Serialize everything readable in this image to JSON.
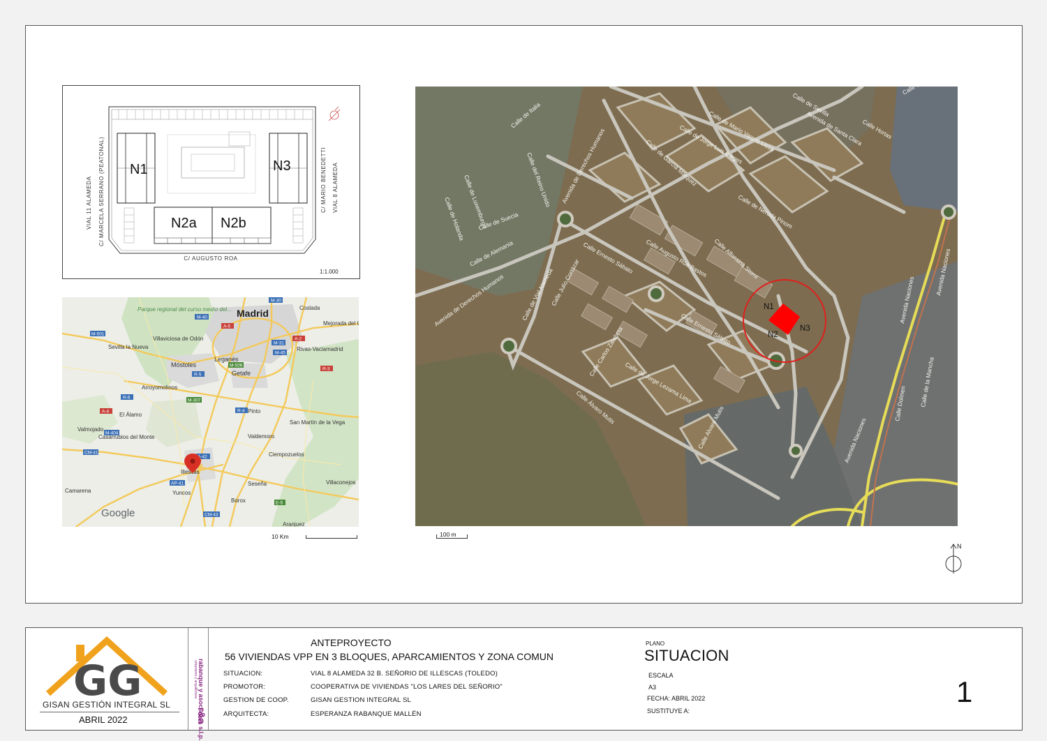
{
  "site_plan": {
    "blocks": {
      "n1": "N1",
      "n2a": "N2a",
      "n2b": "N2b",
      "n3": "N3"
    },
    "streets": {
      "left_outer": "VIAL 11 ALAMEDA",
      "left_inner": "C/ MARCELA SERRANO   (PEATONAL)",
      "right_inner": "C/ MARIO BENEDETTI",
      "right_outer": "VIAL 8 ALAMEDA",
      "bottom": "C/ AUGUSTO ROA"
    },
    "scale": "1:1.000"
  },
  "region_map": {
    "places": {
      "madrid": "Madrid",
      "coslada": "Coslada",
      "mejorada": "Mejorada del Campo",
      "parque": "Parque regional del curso medio del...",
      "villaviciosa": "Villaviciosa de Odón",
      "sevilla": "Sevilla la Nueva",
      "mostoles": "Móstoles",
      "leganes": "Leganés",
      "rivas": "Rivas-Vaciamadrid",
      "getafe": "Getafe",
      "arroyomolinos": "Arroyomolinos",
      "pinto": "Pinto",
      "elalamo": "El Álamo",
      "valmojado": "Valmojado",
      "casarrubios": "Casarrubios del Monte",
      "sanmartin": "San Martín de la Vega",
      "valdemoro": "Valdemoro",
      "ciempozuelos": "Ciempozuelos",
      "illescas": "Illescas",
      "camarena": "Camarena",
      "sesena": "Seseña",
      "yuncos": "Yuncos",
      "borox": "Borox",
      "villaconejos": "Villaconejos",
      "aranjuez": "Aranjuez"
    },
    "roads": {
      "m30": "M-30",
      "m40": "M-40",
      "a5": "A-5",
      "m501": "M-501",
      "m31": "M-31",
      "m45": "M-45",
      "a2": "A-2",
      "m506": "M-506",
      "r5": "R-5",
      "r4": "R-4",
      "r3": "R-3",
      "r6": "R-6",
      "m307": "M-307",
      "a4": "A-4",
      "m404": "M-404",
      "a42": "A-42",
      "cm41": "CM-41",
      "ap41": "AP-41",
      "e5": "E-5",
      "cm43": "CM-43"
    },
    "google": "Google",
    "scale_label": "10 Km"
  },
  "satellite": {
    "streets": [
      "Calle de Italia",
      "Calle de Luxemburgo",
      "Calle del Reino Unido",
      "Calle de Holanda",
      "Calle de Suecia",
      "Calle de Alemania",
      "Avenida de Derechos Humanos",
      "Avenida de Derechos Humanos",
      "Calle de Vial Alameda",
      "Calle Julio Cortázar",
      "Calle Ernesto Sábato",
      "Calle Ernesto Sábato",
      "Calle Carlos Zalabeta",
      "Calle de Jorge Lezama Lima",
      "Calle Álvaro Mutis",
      "Calle Alvaro Mutis",
      "Calle Augusto Roa Bastos",
      "Calle Alfonsina Storni",
      "Calle de García Márquez",
      "Calle de Jorge Luis Borges",
      "Calle de Mario Vargas Llosa",
      "Calle de Neruda Pinom",
      "Avenida de Santa Clara",
      "Calle de Sevilla",
      "Calle Hortas",
      "Calle de Creta",
      "Avenida Naciones",
      "Avenida Naciones",
      "Calle Dolmen",
      "Calle de la Mancha",
      "Avenida Naciones"
    ],
    "markers": {
      "n1": "N1",
      "n2": "N2",
      "n3": "N3"
    },
    "scale_label": "100 m",
    "highlight_color": "#ff0000"
  },
  "north_label": "N",
  "title_block": {
    "company": "GISAN GESTIÓN INTEGRAL SL",
    "date": "ABRIL 2022",
    "partner": "rabanque y asociados s.l.p.",
    "partner_sub": "urbanismo y arquitectura",
    "partner_mark": "r&a",
    "project_type": "ANTEPROYECTO",
    "project_title": "56 VIVIENDAS VPP EN 3 BLOQUES, APARCAMIENTOS Y ZONA COMUN",
    "rows": [
      {
        "label": "SITUACION:",
        "value": "VIAL 8 ALAMEDA 32 B. SEÑORIO DE ILLESCAS (TOLEDO)"
      },
      {
        "label": "PROMOTOR:",
        "value": "COOPERATIVA DE VIVIENDAS \"LOS LARES DEL SEÑORIO\""
      },
      {
        "label": "GESTION DE COOP.",
        "value": "GISAN GESTION INTEGRAL SL"
      },
      {
        "label": "ARQUITECTA:",
        "value": "ESPERANZA RABANQUE MALLÉN"
      }
    ],
    "plano_label": "PLANO",
    "plano_name": "SITUACION",
    "escala_label": "ESCALA",
    "format": "A3",
    "fecha": "FECHA:  ABRIL 2022",
    "sustituye": "SUSTITUYE A:",
    "sheet_number": "1",
    "logo_color": "#f0a21c"
  }
}
